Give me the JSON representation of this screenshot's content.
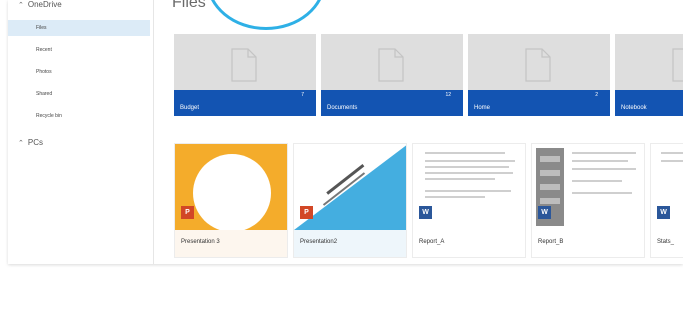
{
  "nav": {
    "onedrive_label": "OneDrive",
    "items": [
      {
        "label": "Files",
        "active": true
      },
      {
        "label": "Recent",
        "active": false
      },
      {
        "label": "Photos",
        "active": false
      },
      {
        "label": "Shared",
        "active": false
      },
      {
        "label": "Recycle bin",
        "active": false
      }
    ],
    "pcs_label": "PCs"
  },
  "main": {
    "title": "Files",
    "folders": [
      {
        "name": "Budget",
        "count": "7"
      },
      {
        "name": "Documents",
        "count": "12"
      },
      {
        "name": "Home",
        "count": "2"
      },
      {
        "name": "Notebook",
        "count": ""
      }
    ],
    "files": [
      {
        "name": "Presentation 3",
        "type": "powerpoint"
      },
      {
        "name": "Presentation2",
        "type": "powerpoint"
      },
      {
        "name": "Report_A",
        "type": "word"
      },
      {
        "name": "Report_B",
        "type": "word"
      },
      {
        "name": "Stats_",
        "type": "word"
      }
    ]
  },
  "colors": {
    "folder_bar": "#1354b2",
    "highlight_ring": "#2eb0e6",
    "nav_active": "#dcebf7",
    "powerpoint": "#d24726",
    "word": "#2b579a"
  }
}
